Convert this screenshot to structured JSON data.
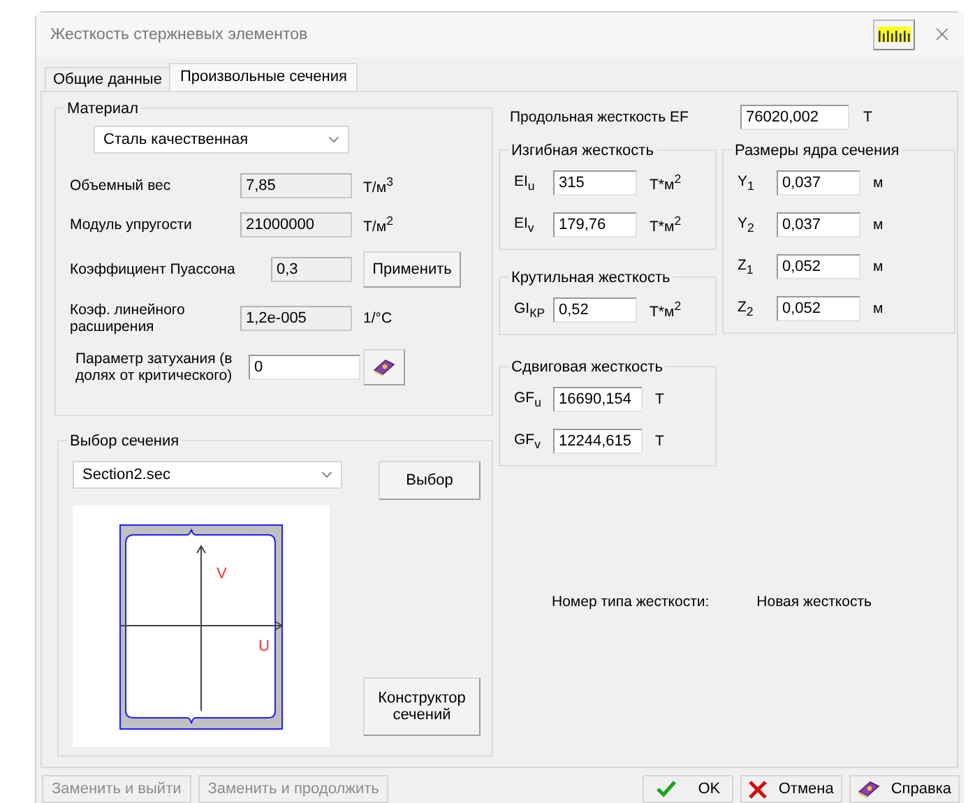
{
  "window": {
    "title": "Жесткость стержневых элементов"
  },
  "tabs": [
    {
      "label": "Общие данные",
      "selected": false
    },
    {
      "label": "Произвольные сечения",
      "selected": true
    }
  ],
  "material": {
    "title": "Материал",
    "select": "Сталь качественная",
    "fields": [
      {
        "label": "Объемный вес",
        "value": "7,85",
        "unit": "Т/м$^{3}$",
        "disabled": true
      },
      {
        "label": "Модуль упругости",
        "value": "21000000",
        "unit": "Т/м$^{2}$",
        "disabled": true
      },
      {
        "label": "Коэффициент Пуассона",
        "value": "0,3",
        "disabled": true,
        "button": {
          "kind": "text",
          "label": "Применить"
        }
      },
      {
        "label": "Коэф. линейного расширения",
        "value": "1,2e-005",
        "unit": "1/°C",
        "disabled": true
      },
      {
        "label": "Параметр затухания (в долях от критического)",
        "value": "0",
        "disabled": false,
        "button": {
          "kind": "book"
        }
      }
    ]
  },
  "section": {
    "title": "Выбор сечения",
    "select": "Section2.sec",
    "choose_button": "Выбор",
    "axis_labels": [
      "V",
      "U"
    ],
    "constructor_button": "Конструктор сечений"
  },
  "ef": {
    "label": "Продольная жесткость EF",
    "value": "76020,002",
    "unit": "Т"
  },
  "bending": {
    "title": "Изгибная жесткость",
    "rows": [
      {
        "label": "EI$_{u}$",
        "value": "315",
        "unit": "Т*м$^{2}$"
      },
      {
        "label": "EI$_{v}$",
        "value": "179,76",
        "unit": "Т*м$^{2}$"
      }
    ]
  },
  "torsion": {
    "title": "Крутильная жесткость",
    "rows": [
      {
        "label": "GI$_{КР}$",
        "value": "0,52",
        "unit": "Т*м$^{2}$"
      }
    ]
  },
  "shear": {
    "title": "Сдвиговая жесткость",
    "rows": [
      {
        "label": "GF$_{u}$",
        "value": "16690,154",
        "unit": "Т"
      },
      {
        "label": "GF$_{v}$",
        "value": "12244,615",
        "unit": "Т"
      }
    ]
  },
  "core": {
    "title": "Размеры ядра сечения",
    "rows": [
      {
        "label": "Y$_{1}$",
        "value": "0,037",
        "unit": "м"
      },
      {
        "label": "Y$_{2}$",
        "value": "0,037",
        "unit": "м"
      },
      {
        "label": "Z$_{1}$",
        "value": "0,052",
        "unit": "м"
      },
      {
        "label": "Z$_{2}$",
        "value": "0,052",
        "unit": "м"
      }
    ]
  },
  "stiffness_type": {
    "label": "Номер типа жесткости:",
    "value": "Новая жесткость"
  },
  "footer": {
    "left_buttons": [
      {
        "label": "Заменить и выйти",
        "disabled": true
      },
      {
        "label": "Заменить и продолжить",
        "disabled": true
      }
    ],
    "right_buttons": [
      {
        "kind": "ok",
        "label": "OK"
      },
      {
        "kind": "cancel",
        "label": "Отмена"
      },
      {
        "kind": "help",
        "label": "Справка"
      }
    ]
  }
}
